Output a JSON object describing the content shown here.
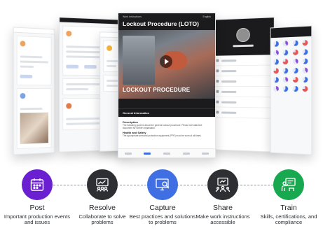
{
  "screen": {
    "title": "Lockout Procedure (LOTO)",
    "back_label": "Work Instructions",
    "language": "English",
    "video_caption": "LOCKOUT PROCEDURE",
    "section_header": "General Information",
    "description_label": "Description",
    "description_text": "The following guide is about the general lockout procedure. Please see attached document for further explanation.",
    "health_label": "Health and Safety",
    "health_text": "The appropriate personal protection equipment (PPE) must be worn at all times."
  },
  "steps": [
    {
      "title": "Post",
      "description": "Important production events and issues",
      "color": "#6a1fd1",
      "icon": "calendar-icon"
    },
    {
      "title": "Resolve",
      "description": "Collaborate to solve problems",
      "color": "#2d2f33",
      "icon": "team-board-icon"
    },
    {
      "title": "Capture",
      "description": "Best practices and solutions to problems",
      "color": "#3f6fe3",
      "icon": "screen-search-icon"
    },
    {
      "title": "Share",
      "description": "Make work instructions accessible",
      "color": "#2d2f33",
      "icon": "share-screen-icon"
    },
    {
      "title": "Train",
      "description": "Skills, certifications, and compliance",
      "color": "#18a84f",
      "icon": "training-icon"
    }
  ]
}
